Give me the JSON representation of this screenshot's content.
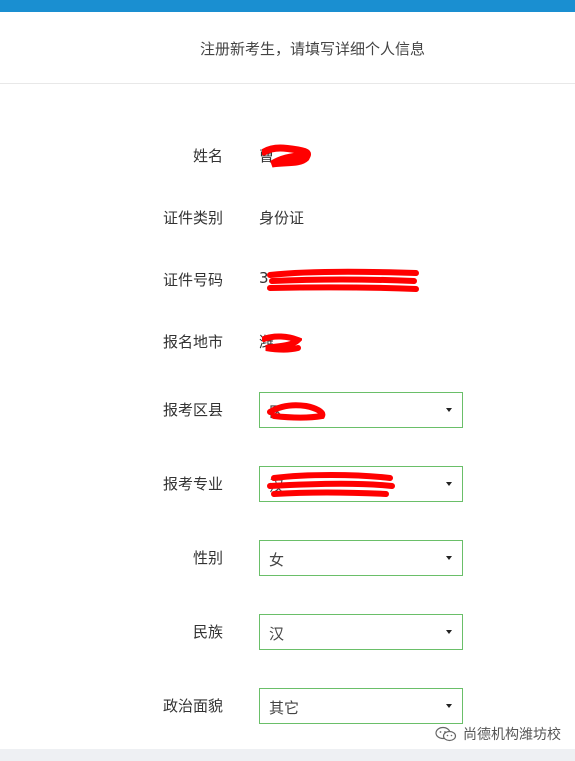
{
  "header": {
    "title": "注册新考生，请填写详细个人信息"
  },
  "form": {
    "name_label": "姓名",
    "name_value": "曹",
    "id_type_label": "证件类别",
    "id_type_value": "身份证",
    "id_number_label": "证件号码",
    "id_number_value": "3",
    "city_label": "报名地市",
    "city_value": "潍",
    "district_label": "报考区县",
    "district_value": "区",
    "major_label": "报考专业",
    "major_value": "汉",
    "gender_label": "性别",
    "gender_value": "女",
    "ethnicity_label": "民族",
    "ethnicity_value": "汉",
    "political_label": "政治面貌",
    "political_value": "其它"
  },
  "watermark": {
    "text": "尚德机构潍坊校"
  },
  "colors": {
    "topbar": "#1a8fd1",
    "select_border": "#6abf69",
    "redaction": "#ff0000"
  }
}
